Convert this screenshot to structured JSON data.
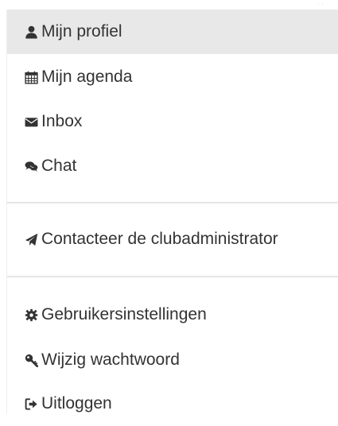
{
  "menu": {
    "items": [
      {
        "label": "Mijn profiel",
        "icon": "user-icon",
        "active": true
      },
      {
        "label": "Mijn agenda",
        "icon": "calendar-icon",
        "active": false
      },
      {
        "label": "Inbox",
        "icon": "envelope-icon",
        "active": false
      },
      {
        "label": "Chat",
        "icon": "comments-icon",
        "active": false
      },
      {
        "label": "Contacteer de clubadministrator",
        "icon": "send-icon",
        "active": false
      },
      {
        "label": "Gebruikersinstellingen",
        "icon": "gear-icon",
        "active": false
      },
      {
        "label": "Wijzig wachtwoord",
        "icon": "key-icon",
        "active": false
      },
      {
        "label": "Uitloggen",
        "icon": "sign-out-icon",
        "active": false
      }
    ]
  },
  "colors": {
    "text": "#333333",
    "active_background": "#e8e8e8",
    "divider": "#e5e5e5"
  }
}
